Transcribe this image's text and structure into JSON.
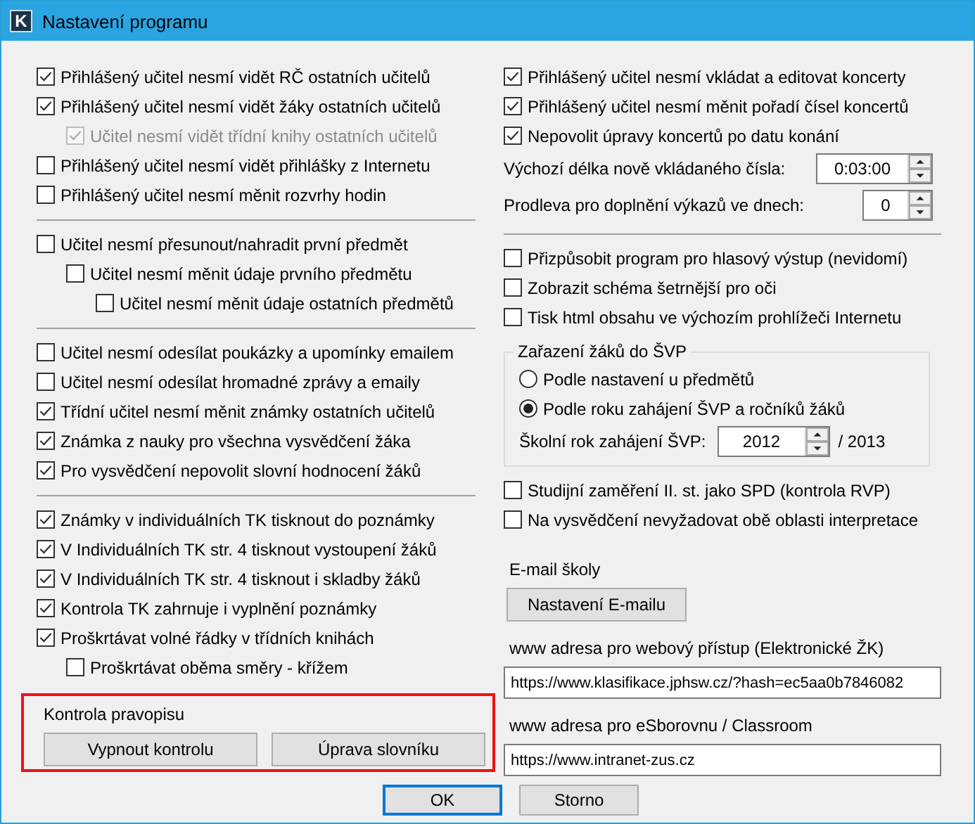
{
  "window": {
    "title": "Nastavení programu",
    "icon_letter": "K"
  },
  "left_sections": [
    {
      "items": [
        {
          "label": "Přihlášený učitel nesmí vidět RČ ostatních učitelů",
          "checked": true,
          "disabled": false
        },
        {
          "label": "Přihlášený učitel nesmí vidět žáky ostatních učitelů",
          "checked": true,
          "disabled": false,
          "children": [
            {
              "label": "Učitel nesmí vidět třídní knihy ostatních učitelů",
              "checked": true,
              "disabled": true
            }
          ]
        },
        {
          "label": "Přihlášený učitel nesmí vidět přihlášky z Internetu",
          "checked": false,
          "disabled": false
        },
        {
          "label": "Přihlášený učitel nesmí měnit rozvrhy hodin",
          "checked": false,
          "disabled": false
        }
      ]
    },
    {
      "items": [
        {
          "label": "Učitel nesmí přesunout/nahradit první předmět",
          "checked": false,
          "disabled": false,
          "children": [
            {
              "label": "Učitel nesmí měnit údaje prvního předmětu",
              "checked": false,
              "disabled": false,
              "children": [
                {
                  "label": "Učitel nesmí měnit údaje ostatních předmětů",
                  "checked": false,
                  "disabled": false
                }
              ]
            }
          ]
        }
      ]
    },
    {
      "items": [
        {
          "label": "Učitel nesmí odesílat poukázky a upomínky emailem",
          "checked": false,
          "disabled": false
        },
        {
          "label": "Učitel nesmí odesílat hromadné zprávy a emaily",
          "checked": false,
          "disabled": false
        },
        {
          "label": "Třídní učitel nesmí měnit známky ostatních učitelů",
          "checked": true,
          "disabled": false
        },
        {
          "label": "Známka z nauky pro všechna vysvědčení žáka",
          "checked": true,
          "disabled": false
        },
        {
          "label": "Pro vysvědčení nepovolit slovní hodnocení žáků",
          "checked": true,
          "disabled": false
        }
      ]
    },
    {
      "items": [
        {
          "label": "Známky v individuálních TK tisknout do poznámky",
          "checked": true,
          "disabled": false
        },
        {
          "label": "V Individuálních TK str. 4 tisknout vystoupení žáků",
          "checked": true,
          "disabled": false
        },
        {
          "label": "V Individuálních TK str. 4 tisknout i skladby žáků",
          "checked": true,
          "disabled": false
        },
        {
          "label": "Kontrola TK zahrnuje i vyplnění poznámky",
          "checked": true,
          "disabled": false
        },
        {
          "label": "Proškrtávat volné řádky v třídních knihách",
          "checked": true,
          "disabled": false,
          "children": [
            {
              "label": "Proškrtávat oběma směry - křížem",
              "checked": false,
              "disabled": false
            }
          ]
        }
      ]
    }
  ],
  "spell_check": {
    "title": "Kontrola pravopisu",
    "highlighted": true,
    "buttons": [
      "Vypnout kontrolu",
      "Úprava slovníku"
    ]
  },
  "right_top": [
    {
      "label": "Přihlášený učitel nesmí vkládat a editovat koncerty",
      "checked": true
    },
    {
      "label": "Přihlášený učitel nesmí měnit pořadí čísel koncertů",
      "checked": true
    },
    {
      "label": "Nepovolit úpravy koncertů po datu konání",
      "checked": true
    }
  ],
  "spin_fields": [
    {
      "label": "Výchozí délka nově vkládaného čísla:",
      "value": "0:03:00"
    },
    {
      "label": "Prodleva pro doplnění výkazů ve dnech:",
      "value": "0"
    }
  ],
  "right_options": [
    {
      "label": "Přizpůsobit program pro hlasový výstup (nevidomí)",
      "checked": false
    },
    {
      "label": "Zobrazit schéma šetrnější pro oči",
      "checked": false
    },
    {
      "label": "Tisk html obsahu ve výchozím prohlížeči Internetu",
      "checked": false
    }
  ],
  "svp_group": {
    "title": "Zařazení žáků do ŠVP",
    "options": [
      {
        "label": "Podle nastavení u předmětů",
        "selected": false
      },
      {
        "label": "Podle roku zahájení ŠVP a ročníků žáků",
        "selected": true
      }
    ],
    "year": {
      "label": "Školní rok zahájení ŠVP:",
      "value": "2012",
      "suffix": "/ 2013"
    }
  },
  "right_more": [
    {
      "label": "Studijní zaměření II. st. jako SPD (kontrola RVP)",
      "checked": false
    },
    {
      "label": "Na vysvědčení nevyžadovat obě oblasti interpretace",
      "checked": false
    }
  ],
  "email": {
    "label": "E-mail školy",
    "button": "Nastavení E-mailu"
  },
  "url_fields": [
    {
      "label": "www adresa pro webový přístup (Elektronické ŽK)",
      "value": "https://www.klasifikace.jphsw.cz/?hash=ec5aa0b7846082"
    },
    {
      "label": "www adresa pro eSborovnu / Classroom",
      "value": "https://www.intranet-zus.cz"
    }
  ],
  "footer_buttons": [
    {
      "label": "OK",
      "focused": true
    },
    {
      "label": "Storno",
      "focused": false
    }
  ]
}
